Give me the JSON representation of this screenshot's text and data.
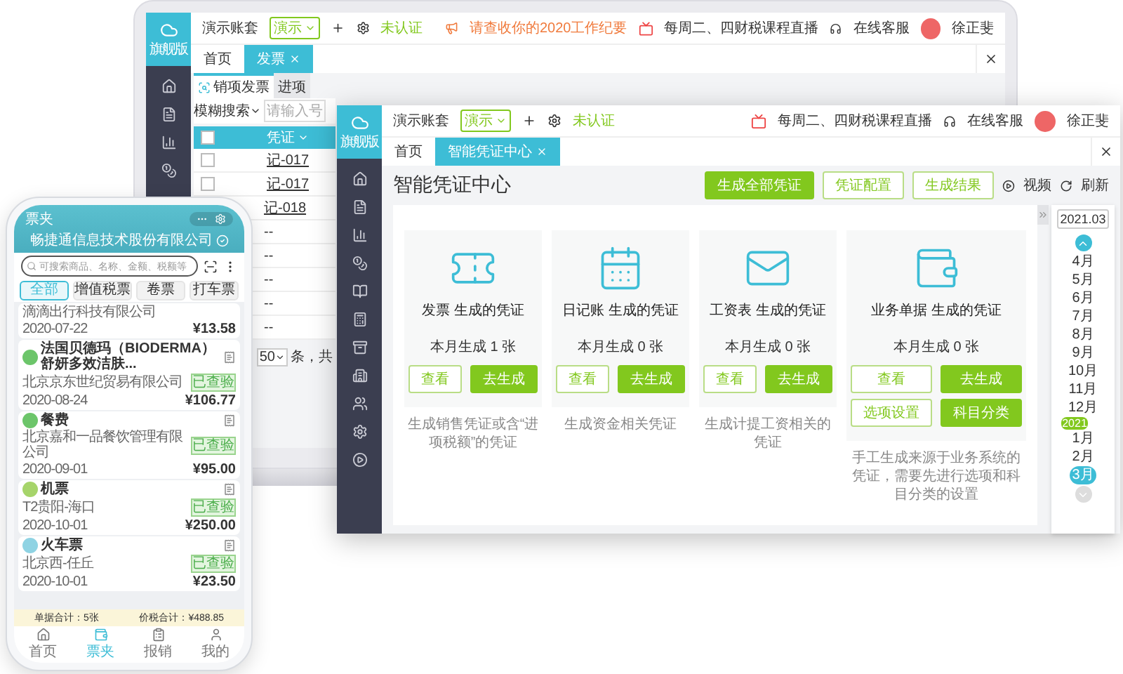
{
  "back_window": {
    "logo_text": "旗舰版",
    "account": "演示账套",
    "account_select": "演示",
    "auth_status": "未认证",
    "notice": "请查收你的2020工作纪要",
    "live_course": "每周二、四财税课程直播",
    "support": "在线客服",
    "user": "徐正斐",
    "tabs": [
      {
        "label": "首页",
        "selected": false
      },
      {
        "label": "发票",
        "selected": true
      }
    ],
    "sub_tabs": [
      {
        "label": "销项发票",
        "selected": true
      },
      {
        "label": "进项",
        "selected": false
      }
    ],
    "search_mode": "模糊搜索",
    "search_placeholder": "请输入号",
    "table": {
      "column": "凭证",
      "all_checked": false,
      "rows": [
        {
          "voucher": "记-017",
          "checked": false
        },
        {
          "voucher": "记-017",
          "checked": false
        },
        {
          "voucher": "记-018",
          "link": true
        },
        {
          "voucher": "--"
        },
        {
          "voucher": "--"
        },
        {
          "voucher": "--"
        },
        {
          "voucher": "--"
        },
        {
          "voucher": "--"
        }
      ]
    },
    "page_size": "50",
    "page_text": "条，共"
  },
  "front_window": {
    "logo_text": "旗舰版",
    "account": "演示账套",
    "account_select": "演示",
    "auth_status": "未认证",
    "live_course": "每周二、四财税课程直播",
    "support": "在线客服",
    "user": "徐正斐",
    "tabs": [
      {
        "label": "首页",
        "selected": false
      },
      {
        "label": "智能凭证中心",
        "selected": true
      }
    ],
    "title": "智能凭证中心",
    "actions": [
      {
        "label": "生成全部凭证",
        "kind": "primary"
      },
      {
        "label": "凭证配置",
        "kind": "outline"
      },
      {
        "label": "生成结果",
        "kind": "outline"
      },
      {
        "label": "视频",
        "kind": "video"
      },
      {
        "label": "刷新",
        "kind": "refresh"
      }
    ],
    "cards": [
      {
        "kind": "invoice",
        "title": "发票 生成的凭证",
        "count": "本月生成 1 张",
        "buttons": [
          {
            "label": "查看",
            "kind": "outline"
          },
          {
            "label": "去生成",
            "kind": "primary"
          }
        ],
        "note": "生成销售凭证或含“进项税额”的凭证"
      },
      {
        "kind": "journal",
        "title": "日记账 生成的凭证",
        "count": "本月生成 0 张",
        "buttons": [
          {
            "label": "查看",
            "kind": "outline"
          },
          {
            "label": "去生成",
            "kind": "primary"
          }
        ],
        "note": "生成资金相关凭证"
      },
      {
        "kind": "payroll",
        "title": "工资表 生成的凭证",
        "count": "本月生成 0 张",
        "buttons": [
          {
            "label": "查看",
            "kind": "outline"
          },
          {
            "label": "去生成",
            "kind": "primary"
          }
        ],
        "note": "生成计提工资相关的凭证"
      },
      {
        "kind": "business",
        "title": "业务单据 生成的凭证",
        "count": "本月生成  0 张",
        "buttons": [
          {
            "label": "查看",
            "kind": "outline"
          },
          {
            "label": "去生成",
            "kind": "primary"
          },
          {
            "label": "选项设置",
            "kind": "outline"
          },
          {
            "label": "科目分类",
            "kind": "primary"
          }
        ],
        "note": "手工生成来源于业务系统的凭证，需要先进行选项和科目分类的设置"
      }
    ],
    "month_picker": {
      "value": "2021.03",
      "months": [
        {
          "label": "4月",
          "selected": false
        },
        {
          "label": "5月",
          "selected": false
        },
        {
          "label": "6月",
          "selected": false
        },
        {
          "label": "7月",
          "selected": false
        },
        {
          "label": "8月",
          "selected": false
        },
        {
          "label": "9月",
          "selected": false
        },
        {
          "label": "10月",
          "selected": false
        },
        {
          "label": "11月",
          "selected": false
        },
        {
          "label": "12月",
          "selected": false
        },
        {
          "label": "1月",
          "selected": false,
          "badge": "2021"
        },
        {
          "label": "2月",
          "selected": false
        },
        {
          "label": "3月",
          "selected": true
        }
      ]
    }
  },
  "phone": {
    "title": "票夹",
    "company": "畅捷通信息技术股份有限公司",
    "search_placeholder": "可搜索商品、名称、金额、税额等",
    "filters": [
      {
        "label": "全部",
        "selected": true
      },
      {
        "label": "增值税票",
        "selected": false
      },
      {
        "label": "卷票",
        "selected": false
      },
      {
        "label": "打车票",
        "selected": false
      }
    ],
    "items": [
      {
        "kind": "partial",
        "seller": "滴滴出行科技有限公司",
        "date": "2020-07-22",
        "amount": "¥13.58"
      },
      {
        "kind": "full",
        "title": "法国贝德玛（BIODERMA）舒妍多效洁肤...",
        "seller": "北京京东世纪贸易有限公司",
        "tag": "已查验",
        "date": "2020-08-24",
        "amount": "¥106.77",
        "color": "#6cc56a"
      },
      {
        "kind": "full",
        "title": "餐费",
        "seller": "北京嘉和一品餐饮管理有限公司",
        "tag": "已查验",
        "date": "2020-09-01",
        "amount": "¥95.00",
        "color": "#6cc56a"
      },
      {
        "kind": "full",
        "title": "机票",
        "seller": "T2贵阳-海口",
        "tag": "已查验",
        "date": "2020-10-01",
        "amount": "¥250.00",
        "color": "#a6d46a"
      },
      {
        "kind": "full",
        "title": "火车票",
        "seller": "北京西-任丘",
        "tag": "已查验",
        "date": "2020-10-01",
        "amount": "¥23.50",
        "color": "#8fd3e3"
      }
    ],
    "summary": [
      "单据合计：5张",
      "价税合计：¥488.85"
    ],
    "nav": [
      {
        "label": "首页",
        "selected": false
      },
      {
        "label": "票夹",
        "selected": true
      },
      {
        "label": "报销",
        "selected": false
      },
      {
        "label": "我的",
        "selected": false
      }
    ]
  }
}
